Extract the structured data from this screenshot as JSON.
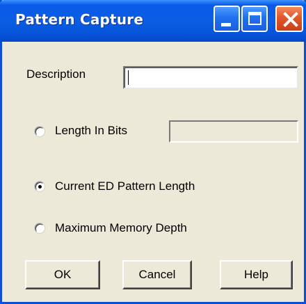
{
  "window": {
    "title": "Pattern Capture",
    "minimize_icon": "minimize-icon",
    "maximize_icon": "maximize-icon",
    "close_icon": "close-icon",
    "titlebar_color": "#0b5ee4",
    "close_color": "#e2572a",
    "face_color": "#ece9d8"
  },
  "form": {
    "description_label": "Description",
    "description_value": "",
    "length_in_bits_label": "Length In Bits",
    "length_in_bits_value": "",
    "current_ed_label": "Current ED Pattern Length",
    "max_memory_label": "Maximum Memory Depth",
    "selected_option": "Current ED Pattern Length"
  },
  "buttons": {
    "ok": "OK",
    "cancel": "Cancel",
    "help": "Help"
  }
}
